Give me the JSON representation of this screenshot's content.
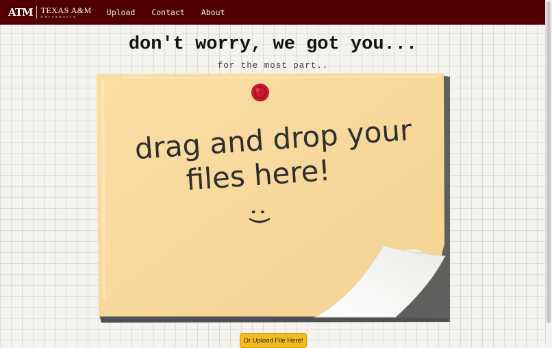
{
  "navbar": {
    "logo": {
      "mark": "ATM",
      "name": "TEXAS A&M",
      "subname": "UNIVERSITY."
    },
    "links": [
      "Upload",
      "Contact",
      "About"
    ]
  },
  "main": {
    "headline": "don't worry, we got you...",
    "subheadline": "for the most part..",
    "dropzone": {
      "line1": "drag and drop your",
      "line2": "files here!",
      "line3": ":)"
    },
    "upload_button": "Or Upload File Here!"
  },
  "colors": {
    "brand_maroon": "#500000",
    "note_paper": "#f7d99a",
    "pin_red": "#c8182c",
    "button_yellow": "#f2bb1f"
  }
}
